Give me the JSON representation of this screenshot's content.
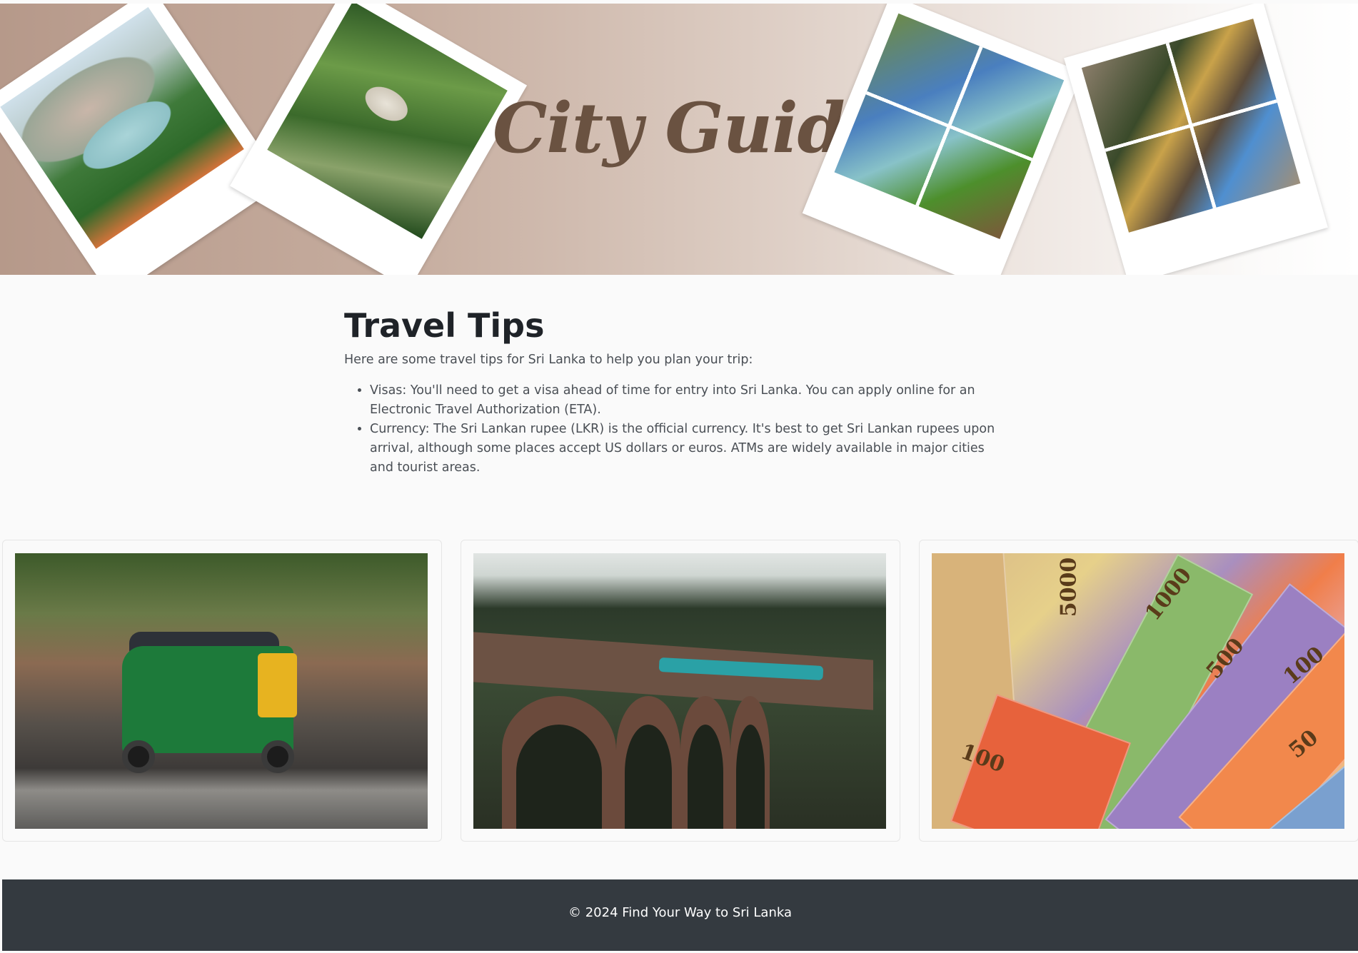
{
  "banner": {
    "title": "City Guide"
  },
  "tips": {
    "heading": "Travel Tips",
    "intro": "Here are some travel tips for Sri Lanka to help you plan your trip:",
    "items": [
      "Visas: You'll need to get a visa ahead of time for entry into Sri Lanka. You can apply online for an Electronic Travel Authorization (ETA).",
      "Currency: The Sri Lankan rupee (LKR) is the official currency. It's best to get Sri Lankan rupees upon arrival, although some places accept US dollars or euros. ATMs are widely available in major cities and tourist areas."
    ]
  },
  "cards": {
    "money_labels": [
      "5000",
      "1000",
      "500",
      "100",
      "50",
      "100"
    ]
  },
  "footer": {
    "text": "© 2024 Find Your Way to Sri Lanka"
  }
}
